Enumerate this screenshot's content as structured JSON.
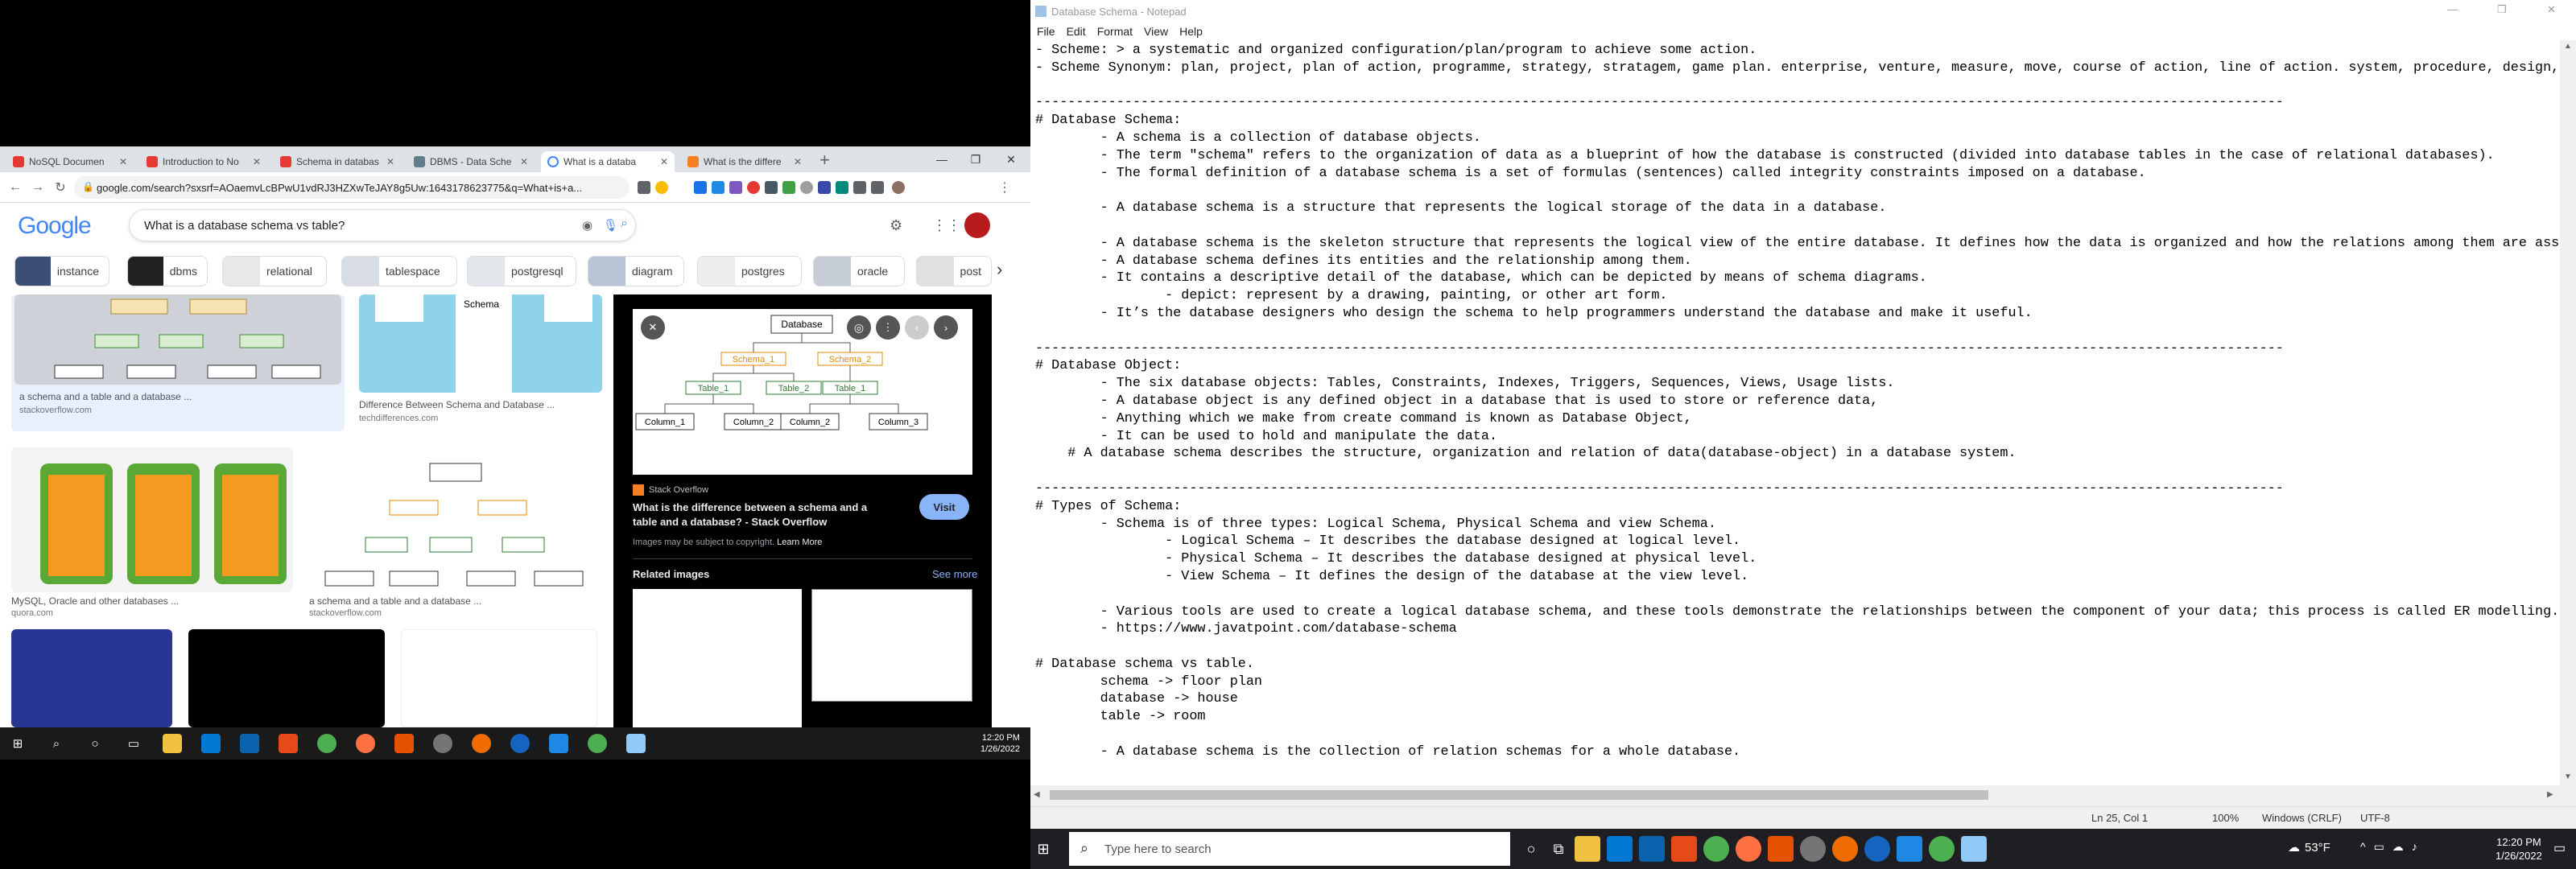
{
  "browser": {
    "tabs": [
      {
        "label": "NoSQL Documen",
        "color": "#e53935"
      },
      {
        "label": "Introduction to No",
        "color": "#e53935"
      },
      {
        "label": "Schema in databas",
        "color": "#e53935"
      },
      {
        "label": "DBMS - Data Sche",
        "color": "#607d8b"
      },
      {
        "label": "What is a databa",
        "color": "#4285f4"
      },
      {
        "label": "What is the differe",
        "color": "#f48024"
      }
    ],
    "url": "google.com/search?sxsrf=AOaemvLcBPwU1vdRJ3HZXwTeJAY8g5Uw:1643178623775&q=What+is+a...",
    "search_query": "What is a database schema vs table?",
    "logo": "Google",
    "chips": [
      "instance",
      "dbms",
      "relational",
      "tablespace",
      "postgresql",
      "diagram",
      "postgres",
      "oracle",
      "post"
    ],
    "results": [
      {
        "title": "a schema and a table and a database ...",
        "source": "stackoverflow.com"
      },
      {
        "title": "Difference Between Schema and Database ...",
        "source": "techdifferences.com"
      },
      {
        "title": "MySQL, Oracle and other databases ...",
        "source": "quora.com"
      },
      {
        "title": "a schema and a table and a database ...",
        "source": "stackoverflow.com"
      }
    ],
    "panel": {
      "source": "Stack Overflow",
      "title": "What is the difference between a schema and a table and a database? - Stack Overflow",
      "notice": "Images may be subject to copyright.",
      "learn_more": "Learn More",
      "visit": "Visit",
      "related": "Related images",
      "see_more": "See more",
      "diagram": {
        "root": "Database",
        "schemas": [
          "Schema_1",
          "Schema_2"
        ],
        "tables": [
          "Table_1",
          "Table_2",
          "Table_1"
        ],
        "columns": [
          "Column_1",
          "Column_2",
          "Column_2",
          "Column_3"
        ]
      }
    },
    "taskbar_time": "12:20 PM",
    "taskbar_date": "1/26/2022"
  },
  "notepad": {
    "title": "Database Schema - Notepad",
    "menu": [
      "File",
      "Edit",
      "Format",
      "View",
      "Help"
    ],
    "lines": [
      "- Scheme: > a systematic and organized configuration/plan/program to achieve some action.",
      "- Scheme Synonym: plan, project, plan of action, programme, strategy, stratagem, game plan. enterprise, venture, measure, move, course of action, line of action. system, procedure, design,",
      "",
      "----------------------------------------------------------------------------------------------------------------------------------------------------------",
      "# Database Schema:",
      "        - A schema is a collection of database objects.",
      "        - The term \"schema\" refers to the organization of data as a blueprint of how the database is constructed (divided into database tables in the case of relational databases).",
      "        - The formal definition of a database schema is a set of formulas (sentences) called integrity constraints imposed on a database.",
      "",
      "        - A database schema is a structure that represents the logical storage of the data in a database.",
      "",
      "        - A database schema is the skeleton structure that represents the logical view of the entire database. It defines how the data is organized and how the relations among them are asso",
      "        - A database schema defines its entities and the relationship among them.",
      "        - It contains a descriptive detail of the database, which can be depicted by means of schema diagrams.",
      "                - depict: represent by a drawing, painting, or other art form.",
      "        - It’s the database designers who design the schema to help programmers understand the database and make it useful.",
      "",
      "----------------------------------------------------------------------------------------------------------------------------------------------------------",
      "# Database Object:",
      "        - The six database objects: Tables, Constraints, Indexes, Triggers, Sequences, Views, Usage lists.",
      "        - A database object is any defined object in a database that is used to store or reference data,",
      "        - Anything which we make from create command is known as Database Object,",
      "        - It can be used to hold and manipulate the data.",
      "    # A database schema describes the structure, organization and relation of data(database-object) in a database system.",
      "",
      "----------------------------------------------------------------------------------------------------------------------------------------------------------",
      "# Types of Schema:",
      "        - Schema is of three types: Logical Schema, Physical Schema and view Schema.",
      "                - Logical Schema – It describes the database designed at logical level.",
      "                - Physical Schema – It describes the database designed at physical level.",
      "                - View Schema – It defines the design of the database at the view level.",
      "",
      "        - Various tools are used to create a logical database schema, and these tools demonstrate the relationships between the component of your data; this process is called ER modelling.",
      "        - https://www.javatpoint.com/database-schema",
      "",
      "# Database schema vs table.",
      "        schema -> floor plan",
      "        database -> house",
      "        table -> room",
      "",
      "        - A database schema is the collection of relation schemas for a whole database."
    ],
    "status": {
      "position": "Ln 25, Col 1",
      "zoom": "100%",
      "eol": "Windows (CRLF)",
      "encoding": "UTF-8"
    }
  },
  "taskbar": {
    "search_placeholder": "Type here to search",
    "weather": "53°F",
    "time": "12:20 PM",
    "date": "1/26/2022"
  }
}
